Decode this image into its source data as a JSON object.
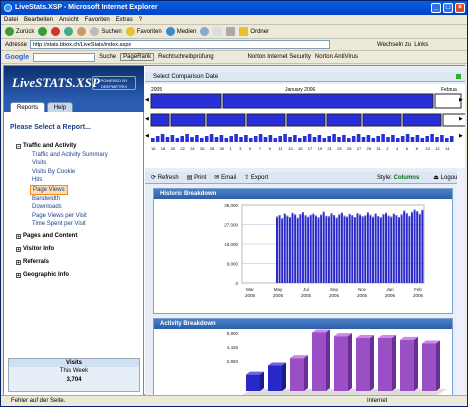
{
  "window": {
    "title": "LiveStats.XSP - Microsoft Internet Explorer"
  },
  "menu": [
    "Datei",
    "Bearbeiten",
    "Ansicht",
    "Favoriten",
    "Extras",
    "?"
  ],
  "toolbar": {
    "back": "Zurück",
    "search": "Suchen",
    "favorites": "Favoriten",
    "media": "Medien",
    "folders": "Ordner"
  },
  "address": {
    "label": "Adresse",
    "value": "http://stats.bbox.ch/LiveStats/index.aspx",
    "go": "Wechseln zu",
    "links": "Links"
  },
  "googlebar": {
    "logo": "Google",
    "search": "Suche",
    "pagerank": "PageRank",
    "spell": "Rechtschreibprüfung",
    "norton": "Norton Internet Security",
    "antivirus": "Norton AntiVirus"
  },
  "app": {
    "logo": "LiveSTATS.XSP",
    "powered": "POWERED BY DEEPMETRIX",
    "tabs": [
      "Reports",
      "Help"
    ],
    "select_prompt": "Please Select a Report...",
    "tree": [
      {
        "label": "Traffic and Activity",
        "expanded": true,
        "items": [
          "Traffic and Activity Summary",
          "Visits",
          "Visits By Cookie",
          "Hits",
          "Page Views",
          "Bandwidth",
          "Downloads",
          "Page Views per Visit",
          "Time Spent per Visit"
        ],
        "selected": "Page Views"
      },
      {
        "label": "Pages and Content",
        "expanded": false
      },
      {
        "label": "Visitor Info",
        "expanded": false
      },
      {
        "label": "Referrals",
        "expanded": false
      },
      {
        "label": "Geographic Info",
        "expanded": false
      }
    ],
    "visits_box": {
      "title": "Visits",
      "period": "This Week",
      "value": "3,704"
    }
  },
  "compare": {
    "label": "Select Comparison Date",
    "year_left": "2005",
    "month_mid": "January 2006",
    "month_right": "Februa",
    "day_labels": [
      "16",
      "18",
      "20",
      "22",
      "24",
      "26",
      "28",
      "30",
      "1",
      "3",
      "5",
      "7",
      "9",
      "11",
      "13",
      "15",
      "17",
      "19",
      "21",
      "23",
      "25",
      "27",
      "29",
      "31",
      "2",
      "4",
      "6",
      "8",
      "10",
      "12",
      "14"
    ]
  },
  "actions": {
    "refresh": "Refresh",
    "print": "Print",
    "email": "Email",
    "export": "Export",
    "style_label": "Style:",
    "style_value": "Columns",
    "logout": "Logout"
  },
  "historic": {
    "title": "Historic Breakdown"
  },
  "activity": {
    "title": "Activity Breakdown"
  },
  "chart_data": [
    {
      "type": "bar",
      "title": "Historic Breakdown",
      "categories": [
        "Mar 2005",
        "May 2005",
        "Jul 2005",
        "Sep 2005",
        "Nov 2005",
        "Jan 2006",
        "Feb 2006"
      ],
      "yticks": [
        "35,000",
        "27,000",
        "18,000",
        "9,000",
        "0"
      ],
      "ylim": [
        0,
        35000
      ],
      "values": [
        29800,
        30500,
        29000,
        31200,
        30200,
        29600,
        31500,
        30800,
        29300,
        30900,
        31800,
        30400,
        29700,
        30600,
        31100,
        30300,
        29500,
        30700,
        32000,
        30100,
        29900,
        31300,
        30500,
        29400,
        30800,
        31600,
        30200,
        29800,
        31000,
        30400,
        29600,
        31400,
        30700,
        29900,
        30300,
        31700,
        30600,
        29700,
        31200,
        30000,
        29500,
        30900,
        31500,
        30200,
        29800,
        31100,
        30500,
        29600,
        30800,
        32500,
        31300,
        30100,
        31900,
        33000,
        32200,
        31000,
        32800
      ]
    },
    {
      "type": "bar",
      "title": "Activity Breakdown",
      "yticks": [
        "5,900",
        "4,425",
        "2,950"
      ],
      "values": [
        3300,
        3800,
        4200,
        5600,
        5400,
        5300,
        5300,
        5200,
        5000
      ]
    }
  ],
  "status": {
    "text": "Fehler auf der Seite.",
    "zone": "Internet"
  },
  "colors": {
    "accent": "#2a5cb0",
    "bar": "#2828c8",
    "bar_top": "#6a6ae0",
    "purple": "#9a4fc4"
  }
}
